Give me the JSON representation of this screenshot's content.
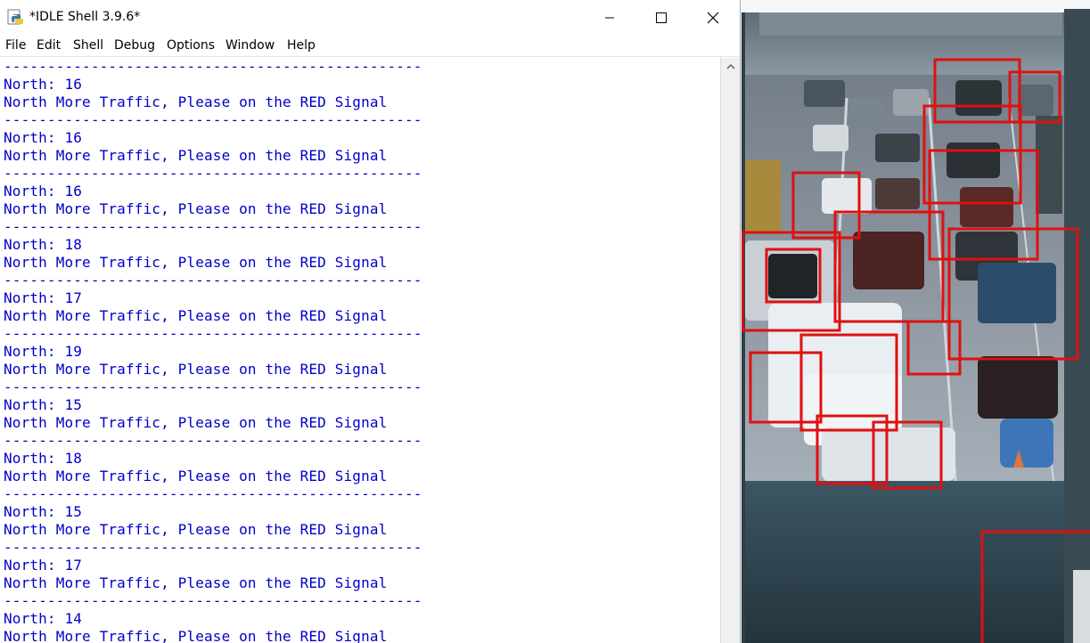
{
  "window": {
    "title": "*IDLE Shell 3.9.6*"
  },
  "menu": {
    "items": [
      "File",
      "Edit",
      "Shell",
      "Debug",
      "Options",
      "Window",
      "Help"
    ]
  },
  "shell": {
    "separator": "------------------------------------------------",
    "message": "North More Traffic, Please on the RED Signal",
    "counts": [
      "North: 16",
      "North: 16",
      "North: 16",
      "North: 18",
      "North: 17",
      "North: 19",
      "North: 15",
      "North: 18",
      "North: 15",
      "North: 17",
      "North: 14"
    ]
  },
  "colors": {
    "shell_output": "#0000c8",
    "detection_box": "#e01010"
  },
  "icons": {
    "app": "python-idle-icon",
    "minimize": "minimize-icon",
    "maximize": "maximize-icon",
    "close": "close-icon",
    "scroll_up": "chevron-up-icon"
  }
}
